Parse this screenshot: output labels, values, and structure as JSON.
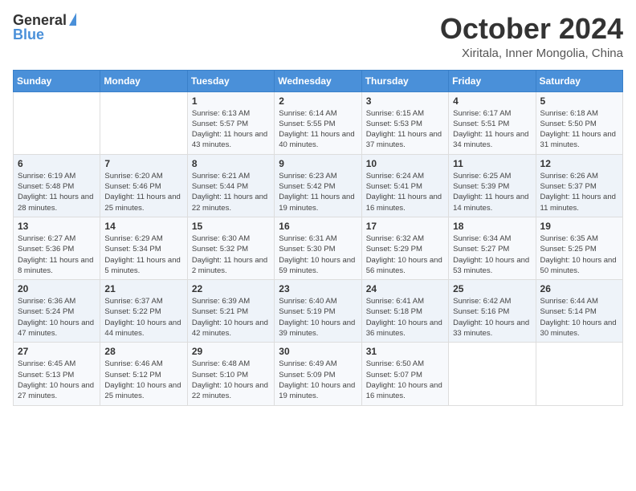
{
  "header": {
    "logo_general": "General",
    "logo_blue": "Blue",
    "month": "October 2024",
    "location": "Xiritala, Inner Mongolia, China"
  },
  "weekdays": [
    "Sunday",
    "Monday",
    "Tuesday",
    "Wednesday",
    "Thursday",
    "Friday",
    "Saturday"
  ],
  "weeks": [
    [
      {
        "day": "",
        "info": ""
      },
      {
        "day": "",
        "info": ""
      },
      {
        "day": "1",
        "info": "Sunrise: 6:13 AM\nSunset: 5:57 PM\nDaylight: 11 hours and 43 minutes."
      },
      {
        "day": "2",
        "info": "Sunrise: 6:14 AM\nSunset: 5:55 PM\nDaylight: 11 hours and 40 minutes."
      },
      {
        "day": "3",
        "info": "Sunrise: 6:15 AM\nSunset: 5:53 PM\nDaylight: 11 hours and 37 minutes."
      },
      {
        "day": "4",
        "info": "Sunrise: 6:17 AM\nSunset: 5:51 PM\nDaylight: 11 hours and 34 minutes."
      },
      {
        "day": "5",
        "info": "Sunrise: 6:18 AM\nSunset: 5:50 PM\nDaylight: 11 hours and 31 minutes."
      }
    ],
    [
      {
        "day": "6",
        "info": "Sunrise: 6:19 AM\nSunset: 5:48 PM\nDaylight: 11 hours and 28 minutes."
      },
      {
        "day": "7",
        "info": "Sunrise: 6:20 AM\nSunset: 5:46 PM\nDaylight: 11 hours and 25 minutes."
      },
      {
        "day": "8",
        "info": "Sunrise: 6:21 AM\nSunset: 5:44 PM\nDaylight: 11 hours and 22 minutes."
      },
      {
        "day": "9",
        "info": "Sunrise: 6:23 AM\nSunset: 5:42 PM\nDaylight: 11 hours and 19 minutes."
      },
      {
        "day": "10",
        "info": "Sunrise: 6:24 AM\nSunset: 5:41 PM\nDaylight: 11 hours and 16 minutes."
      },
      {
        "day": "11",
        "info": "Sunrise: 6:25 AM\nSunset: 5:39 PM\nDaylight: 11 hours and 14 minutes."
      },
      {
        "day": "12",
        "info": "Sunrise: 6:26 AM\nSunset: 5:37 PM\nDaylight: 11 hours and 11 minutes."
      }
    ],
    [
      {
        "day": "13",
        "info": "Sunrise: 6:27 AM\nSunset: 5:36 PM\nDaylight: 11 hours and 8 minutes."
      },
      {
        "day": "14",
        "info": "Sunrise: 6:29 AM\nSunset: 5:34 PM\nDaylight: 11 hours and 5 minutes."
      },
      {
        "day": "15",
        "info": "Sunrise: 6:30 AM\nSunset: 5:32 PM\nDaylight: 11 hours and 2 minutes."
      },
      {
        "day": "16",
        "info": "Sunrise: 6:31 AM\nSunset: 5:30 PM\nDaylight: 10 hours and 59 minutes."
      },
      {
        "day": "17",
        "info": "Sunrise: 6:32 AM\nSunset: 5:29 PM\nDaylight: 10 hours and 56 minutes."
      },
      {
        "day": "18",
        "info": "Sunrise: 6:34 AM\nSunset: 5:27 PM\nDaylight: 10 hours and 53 minutes."
      },
      {
        "day": "19",
        "info": "Sunrise: 6:35 AM\nSunset: 5:25 PM\nDaylight: 10 hours and 50 minutes."
      }
    ],
    [
      {
        "day": "20",
        "info": "Sunrise: 6:36 AM\nSunset: 5:24 PM\nDaylight: 10 hours and 47 minutes."
      },
      {
        "day": "21",
        "info": "Sunrise: 6:37 AM\nSunset: 5:22 PM\nDaylight: 10 hours and 44 minutes."
      },
      {
        "day": "22",
        "info": "Sunrise: 6:39 AM\nSunset: 5:21 PM\nDaylight: 10 hours and 42 minutes."
      },
      {
        "day": "23",
        "info": "Sunrise: 6:40 AM\nSunset: 5:19 PM\nDaylight: 10 hours and 39 minutes."
      },
      {
        "day": "24",
        "info": "Sunrise: 6:41 AM\nSunset: 5:18 PM\nDaylight: 10 hours and 36 minutes."
      },
      {
        "day": "25",
        "info": "Sunrise: 6:42 AM\nSunset: 5:16 PM\nDaylight: 10 hours and 33 minutes."
      },
      {
        "day": "26",
        "info": "Sunrise: 6:44 AM\nSunset: 5:14 PM\nDaylight: 10 hours and 30 minutes."
      }
    ],
    [
      {
        "day": "27",
        "info": "Sunrise: 6:45 AM\nSunset: 5:13 PM\nDaylight: 10 hours and 27 minutes."
      },
      {
        "day": "28",
        "info": "Sunrise: 6:46 AM\nSunset: 5:12 PM\nDaylight: 10 hours and 25 minutes."
      },
      {
        "day": "29",
        "info": "Sunrise: 6:48 AM\nSunset: 5:10 PM\nDaylight: 10 hours and 22 minutes."
      },
      {
        "day": "30",
        "info": "Sunrise: 6:49 AM\nSunset: 5:09 PM\nDaylight: 10 hours and 19 minutes."
      },
      {
        "day": "31",
        "info": "Sunrise: 6:50 AM\nSunset: 5:07 PM\nDaylight: 10 hours and 16 minutes."
      },
      {
        "day": "",
        "info": ""
      },
      {
        "day": "",
        "info": ""
      }
    ]
  ]
}
